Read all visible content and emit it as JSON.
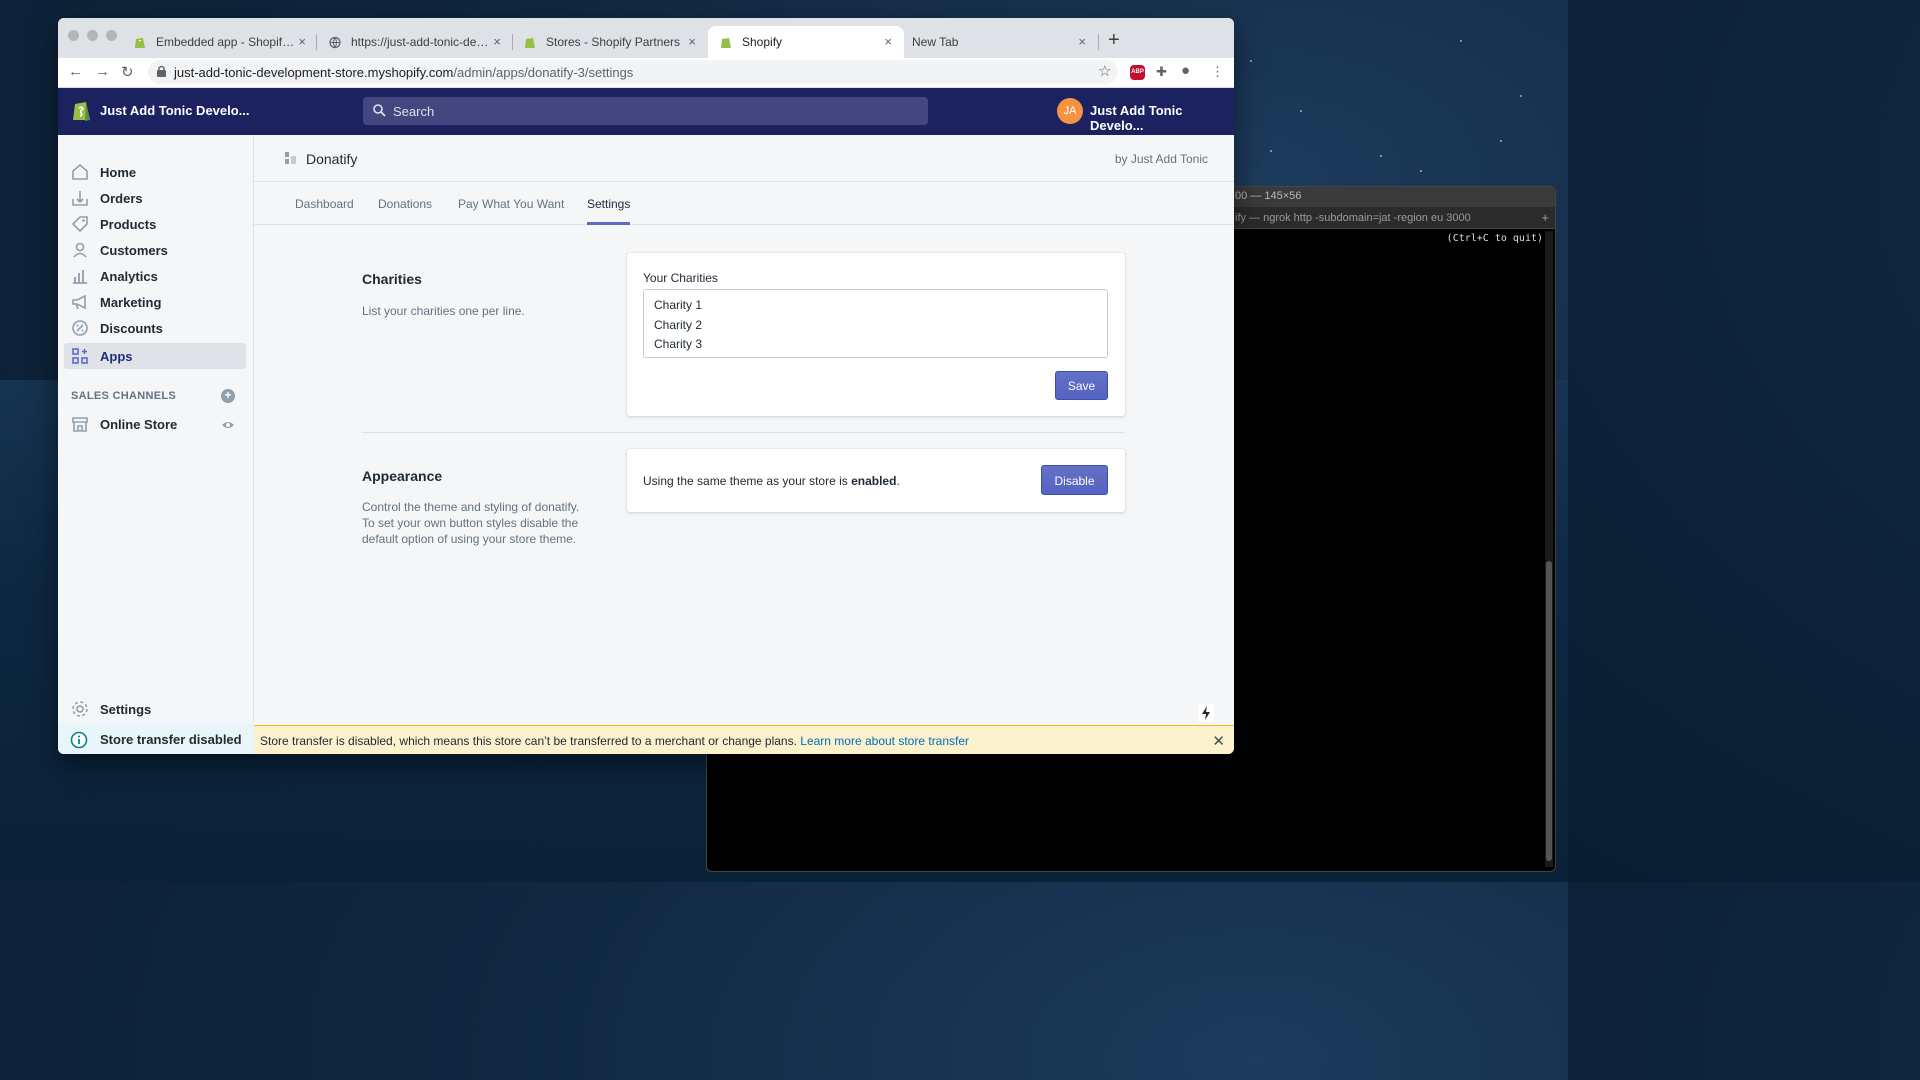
{
  "browser": {
    "tabs": [
      {
        "title": "Embedded app - Shopify Partners"
      },
      {
        "title": "https://just-add-tonic-development-store.myshopify.com"
      },
      {
        "title": "Stores - Shopify Partners"
      },
      {
        "title": "Shopify"
      },
      {
        "title": "New Tab"
      }
    ],
    "url_host": "just-add-tonic-development-store.myshopify.com",
    "url_path": "/admin/apps/donatify-3/settings"
  },
  "terminal": {
    "title": "00 — 145×56",
    "tab": "ify — ngrok http -subdomain=jat -region eu 3000",
    "output": "(Ctrl+C to quit)"
  },
  "topbar": {
    "store_name": "Just Add Tonic Develo...",
    "search_placeholder": "Search",
    "avatar_initials": "JA",
    "account_name": "Just Add Tonic Develo..."
  },
  "sidebar": {
    "items": [
      {
        "label": "Home"
      },
      {
        "label": "Orders"
      },
      {
        "label": "Products"
      },
      {
        "label": "Customers"
      },
      {
        "label": "Analytics"
      },
      {
        "label": "Marketing"
      },
      {
        "label": "Discounts"
      },
      {
        "label": "Apps"
      }
    ],
    "sales_channels_heading": "SALES CHANNELS",
    "online_store": "Online Store",
    "settings": "Settings",
    "transfer": "Store transfer disabled"
  },
  "app": {
    "title": "Donatify",
    "by": "by Just Add Tonic",
    "tabs": [
      "Dashboard",
      "Donations",
      "Pay What You Want",
      "Settings"
    ],
    "active_tab": "Settings"
  },
  "charities": {
    "title": "Charities",
    "description": "List your charities one per line.",
    "field_label": "Your Charities",
    "lines": [
      "Charity 1",
      "Charity 2",
      "Charity 3"
    ],
    "save_label": "Save"
  },
  "appearance": {
    "title": "Appearance",
    "description": "Control the theme and styling of donatify. To set your own button styles disable the default option of using your store theme.",
    "text_prefix": "Using the same theme as your store is ",
    "text_status": "enabled",
    "text_suffix": ".",
    "disable_label": "Disable"
  },
  "banner": {
    "text": "Store transfer is disabled, which means this store can’t be transferred to a merchant or change plans. ",
    "link": "Learn more about store transfer"
  },
  "colors": {
    "topbar": "#1c2260",
    "primary_button": "#5c6ac4",
    "banner_bg": "#fcf1cd",
    "avatar": "#f49342"
  }
}
